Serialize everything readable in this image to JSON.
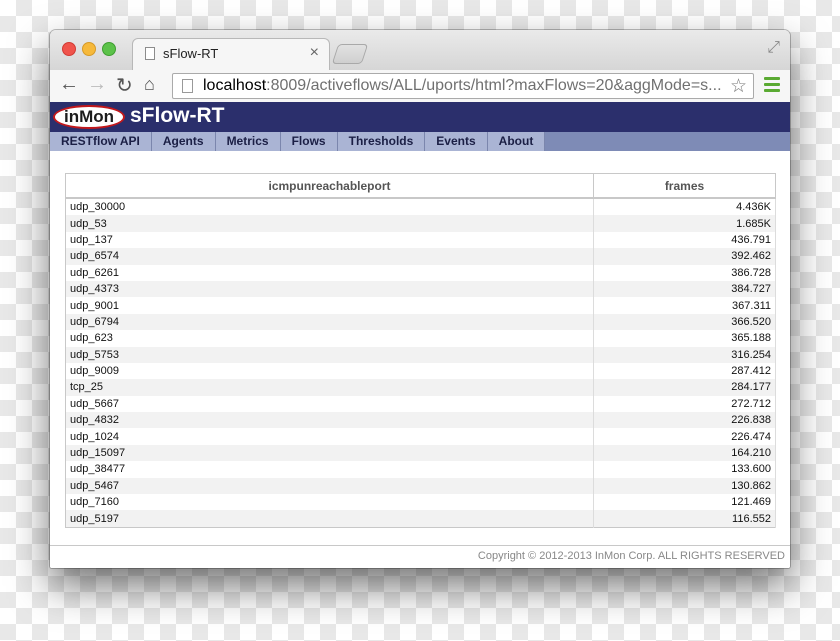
{
  "browser": {
    "tab_title": "sFlow-RT",
    "tab_close": "×",
    "url_host": "localhost",
    "url_rest": ":8009/activeflows/ALL/uports/html?maxFlows=20&aggMode=s...",
    "back_glyph": "←",
    "forward_glyph": "→",
    "reload_glyph": "↻",
    "home_glyph": "⌂",
    "star_glyph": "☆",
    "fullscreen_glyph": "⤢"
  },
  "app": {
    "logo_text": "inMon",
    "title": "sFlow-RT",
    "menu": [
      {
        "label": "RESTflow API"
      },
      {
        "label": "Agents"
      },
      {
        "label": "Metrics"
      },
      {
        "label": "Flows"
      },
      {
        "label": "Thresholds"
      },
      {
        "label": "Events"
      },
      {
        "label": "About"
      }
    ]
  },
  "table": {
    "headers": [
      "icmpunreachableport",
      "frames"
    ],
    "rows": [
      [
        "udp_30000",
        "4.436K"
      ],
      [
        "udp_53",
        "1.685K"
      ],
      [
        "udp_137",
        "436.791"
      ],
      [
        "udp_6574",
        "392.462"
      ],
      [
        "udp_6261",
        "386.728"
      ],
      [
        "udp_4373",
        "384.727"
      ],
      [
        "udp_9001",
        "367.311"
      ],
      [
        "udp_6794",
        "366.520"
      ],
      [
        "udp_623",
        "365.188"
      ],
      [
        "udp_5753",
        "316.254"
      ],
      [
        "udp_9009",
        "287.412"
      ],
      [
        "tcp_25",
        "284.177"
      ],
      [
        "udp_5667",
        "272.712"
      ],
      [
        "udp_4832",
        "226.838"
      ],
      [
        "udp_1024",
        "226.474"
      ],
      [
        "udp_15097",
        "164.210"
      ],
      [
        "udp_38477",
        "133.600"
      ],
      [
        "udp_5467",
        "130.862"
      ],
      [
        "udp_7160",
        "121.469"
      ],
      [
        "udp_5197",
        "116.552"
      ]
    ]
  },
  "footer": {
    "copyright": "Copyright © 2012-2013 InMon Corp. ALL RIGHTS RESERVED"
  },
  "colors": {
    "brand_bar": "#2b2f6c",
    "menu_bar": "#aab4d4",
    "logo_ring": "#c2181c",
    "menu_icon": "#5aaa32"
  }
}
